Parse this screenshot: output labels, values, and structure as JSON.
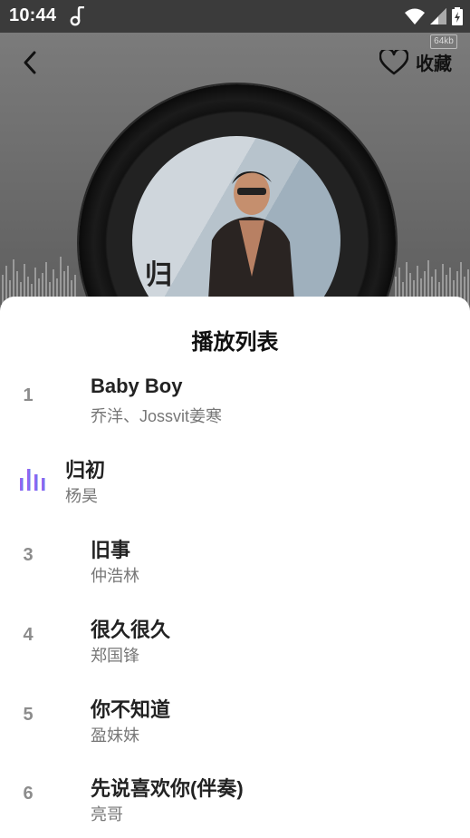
{
  "status_bar": {
    "time": "10:44"
  },
  "player": {
    "favorite_label": "收藏",
    "quality_badge": "64kb",
    "cover_text": "归",
    "accent_color": "#7b5cf0"
  },
  "playlist": {
    "title": "播放列表",
    "items": [
      {
        "number": "1",
        "title": "Baby Boy",
        "artist": " 乔洋、Jossvit姜寒",
        "playing": false
      },
      {
        "number": "",
        "title": "归初",
        "artist": "杨昊",
        "playing": true
      },
      {
        "number": "3",
        "title": "旧事",
        "artist": "仲浩林",
        "playing": false
      },
      {
        "number": "4",
        "title": "很久很久",
        "artist": "郑国锋",
        "playing": false
      },
      {
        "number": "5",
        "title": "你不知道",
        "artist": "盈妹妹",
        "playing": false
      },
      {
        "number": "6",
        "title": "先说喜欢你(伴奏)",
        "artist": "亮哥",
        "playing": false
      }
    ]
  }
}
